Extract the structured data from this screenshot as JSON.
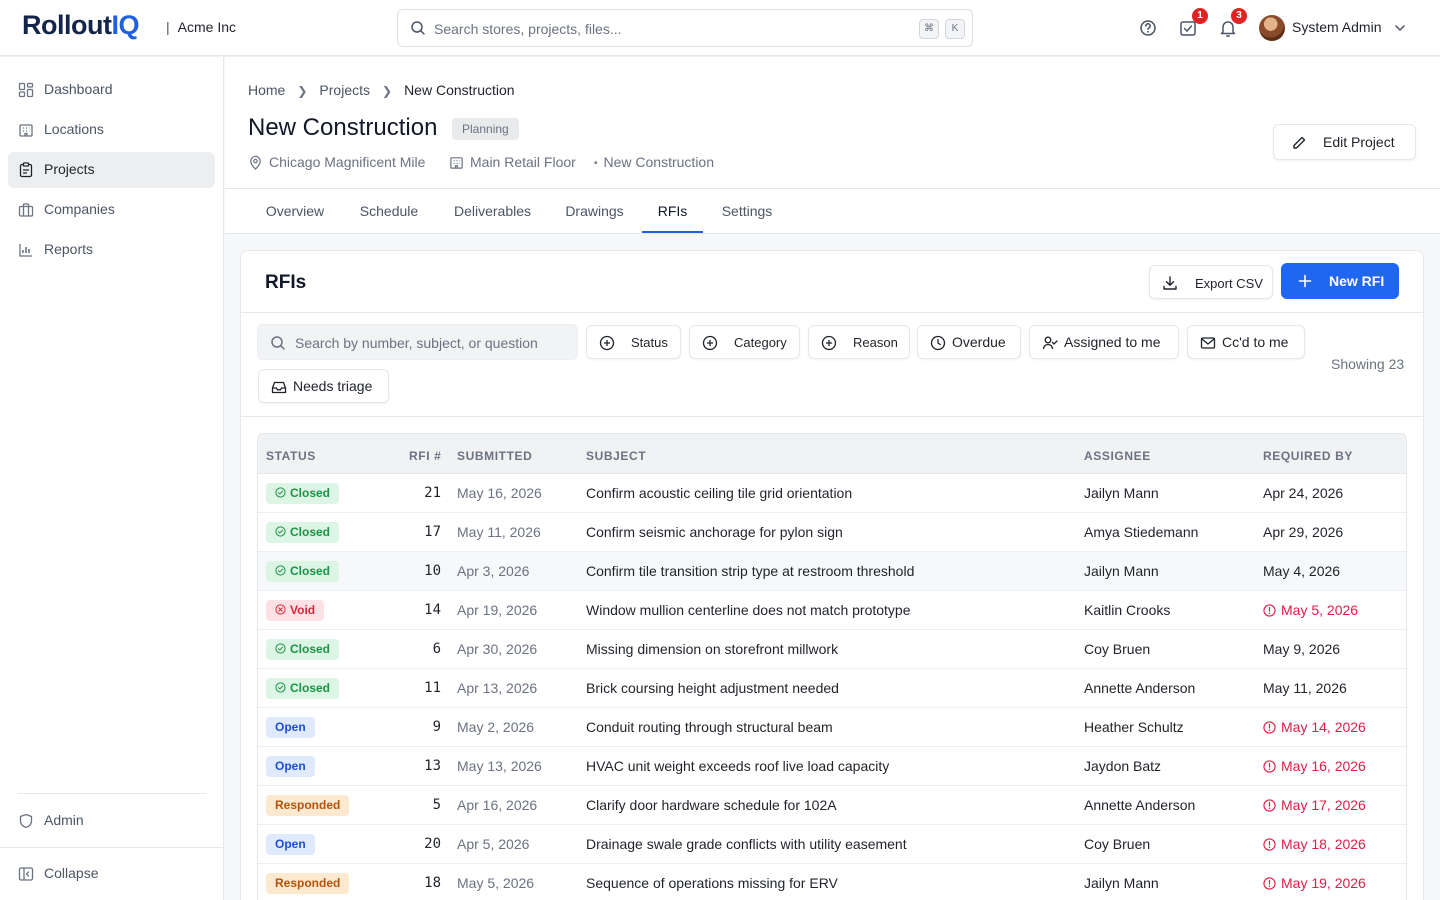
{
  "app": {
    "logo_main": "Rollout",
    "logo_accent": "IQ",
    "org_sep": "|",
    "org_name": "Acme Inc"
  },
  "topbar": {
    "search_placeholder": "Search stores, projects, files...",
    "kbd_1": "⌘",
    "kbd_2": "K",
    "tasks_badge": "1",
    "notifications_badge": "3",
    "user_name": "System Admin"
  },
  "sidebar": {
    "items": [
      {
        "label": "Dashboard",
        "icon": "dashboard-icon"
      },
      {
        "label": "Locations",
        "icon": "building-icon"
      },
      {
        "label": "Projects",
        "icon": "clipboard-icon",
        "active": true
      },
      {
        "label": "Companies",
        "icon": "briefcase-icon"
      },
      {
        "label": "Reports",
        "icon": "bar-chart-icon"
      }
    ],
    "admin_label": "Admin",
    "collapse_label": "Collapse"
  },
  "breadcrumb": {
    "home": "Home",
    "projects": "Projects",
    "current": "New Construction"
  },
  "project": {
    "title": "New Construction",
    "status": "Planning",
    "location": "Chicago Magnificent Mile",
    "floor": "Main Retail Floor",
    "type": "New Construction",
    "edit_label": "Edit Project"
  },
  "tabs": [
    "Overview",
    "Schedule",
    "Deliverables",
    "Drawings",
    "RFIs",
    "Settings"
  ],
  "active_tab": "RFIs",
  "rfis": {
    "title": "RFIs",
    "export_label": "Export CSV",
    "new_label": "New RFI",
    "search_placeholder": "Search by number, subject, or question",
    "filters": {
      "status": "Status",
      "category": "Category",
      "reason": "Reason",
      "overdue": "Overdue",
      "assigned": "Assigned to me",
      "ccd": "Cc'd to me",
      "triage": "Needs triage"
    },
    "showing": "Showing 23",
    "columns": {
      "status": "STATUS",
      "number": "RFI #",
      "submitted": "SUBMITTED",
      "subject": "SUBJECT",
      "assignee": "ASSIGNEE",
      "required": "REQUIRED BY"
    },
    "rows": [
      {
        "status": "Closed",
        "number": "21",
        "submitted": "May 16, 2026",
        "subject": "Confirm acoustic ceiling tile grid orientation",
        "assignee": "Jailyn Mann",
        "required": "Apr 24, 2026",
        "overdue": false
      },
      {
        "status": "Closed",
        "number": "17",
        "submitted": "May 11, 2026",
        "subject": "Confirm seismic anchorage for pylon sign",
        "assignee": "Amya Stiedemann",
        "required": "Apr 29, 2026",
        "overdue": false
      },
      {
        "status": "Closed",
        "number": "10",
        "submitted": "Apr 3, 2026",
        "subject": "Confirm tile transition strip type at restroom threshold",
        "assignee": "Jailyn Mann",
        "required": "May 4, 2026",
        "overdue": false
      },
      {
        "status": "Void",
        "number": "14",
        "submitted": "Apr 19, 2026",
        "subject": "Window mullion centerline does not match prototype",
        "assignee": "Kaitlin Crooks",
        "required": "May 5, 2026",
        "overdue": true
      },
      {
        "status": "Closed",
        "number": "6",
        "submitted": "Apr 30, 2026",
        "subject": "Missing dimension on storefront millwork",
        "assignee": "Coy Bruen",
        "required": "May 9, 2026",
        "overdue": false
      },
      {
        "status": "Closed",
        "number": "11",
        "submitted": "Apr 13, 2026",
        "subject": "Brick coursing height adjustment needed",
        "assignee": "Annette Anderson",
        "required": "May 11, 2026",
        "overdue": false
      },
      {
        "status": "Open",
        "number": "9",
        "submitted": "May 2, 2026",
        "subject": "Conduit routing through structural beam",
        "assignee": "Heather Schultz",
        "required": "May 14, 2026",
        "overdue": true
      },
      {
        "status": "Open",
        "number": "13",
        "submitted": "May 13, 2026",
        "subject": "HVAC unit weight exceeds roof live load capacity",
        "assignee": "Jaydon Batz",
        "required": "May 16, 2026",
        "overdue": true
      },
      {
        "status": "Responded",
        "number": "5",
        "submitted": "Apr 16, 2026",
        "subject": "Clarify door hardware schedule for 102A",
        "assignee": "Annette Anderson",
        "required": "May 17, 2026",
        "overdue": true
      },
      {
        "status": "Open",
        "number": "20",
        "submitted": "Apr 5, 2026",
        "subject": "Drainage swale grade conflicts with utility easement",
        "assignee": "Coy Bruen",
        "required": "May 18, 2026",
        "overdue": true
      },
      {
        "status": "Responded",
        "number": "18",
        "submitted": "May 5, 2026",
        "subject": "Sequence of operations missing for ERV",
        "assignee": "Jailyn Mann",
        "required": "May 19, 2026",
        "overdue": true
      }
    ]
  },
  "colors": {
    "accent": "#1f66f0",
    "brand_dark": "#14254a",
    "overdue": "#e11d48"
  }
}
